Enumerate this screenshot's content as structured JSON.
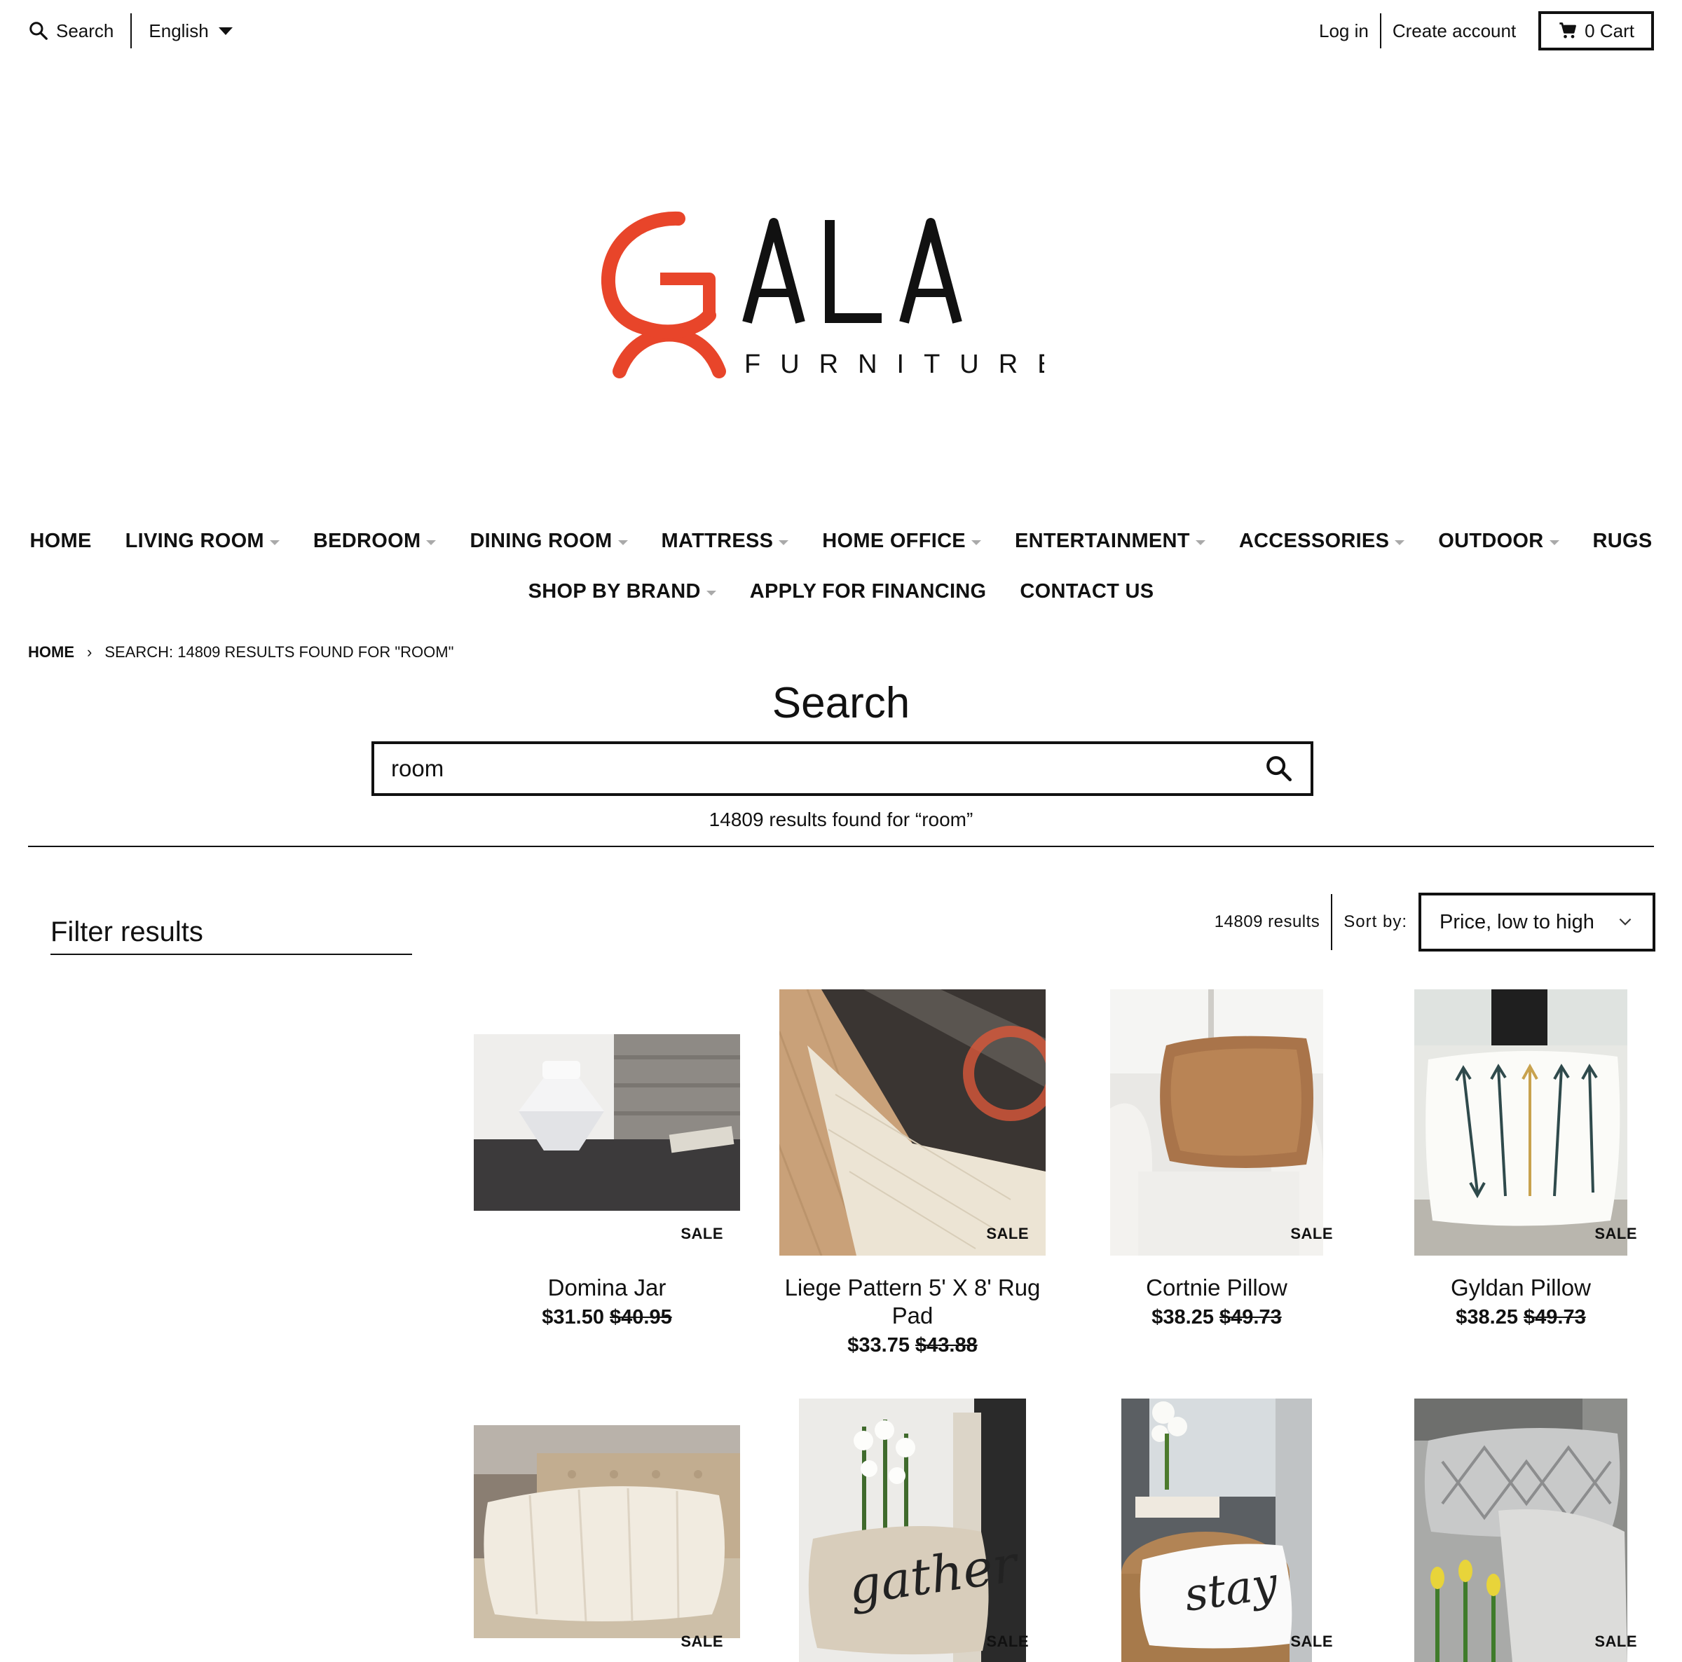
{
  "topbar": {
    "search_label": "Search",
    "language": "English",
    "login": "Log in",
    "create_account": "Create account",
    "cart_count": "0",
    "cart_label": "Cart"
  },
  "logo": {
    "name": "GALA",
    "tagline": "FURNITURE",
    "brand_color": "#e8452a"
  },
  "nav": {
    "row1": [
      "HOME",
      "LIVING ROOM",
      "BEDROOM",
      "DINING ROOM",
      "MATTRESS",
      "HOME OFFICE",
      "ENTERTAINMENT",
      "ACCESSORIES",
      "OUTDOOR",
      "RUGS"
    ],
    "row2": [
      "SHOP BY BRAND",
      "APPLY FOR FINANCING",
      "CONTACT US"
    ]
  },
  "breadcrumb": {
    "home": "HOME",
    "separator": "›",
    "current": "SEARCH: 14809 RESULTS FOUND FOR \"ROOM\""
  },
  "search": {
    "title": "Search",
    "query": "room",
    "results_text": "14809 results found for “room”"
  },
  "filter": {
    "title": "Filter results"
  },
  "sort": {
    "count": "14809 results",
    "label": "Sort by:",
    "selected": "Price, low to high"
  },
  "products": [
    {
      "name": "Domina Jar",
      "price": "$31.50",
      "old_price": "$40.95",
      "badge": "SALE"
    },
    {
      "name": "Liege Pattern 5' X 8' Rug Pad",
      "price": "$33.75",
      "old_price": "$43.88",
      "badge": "SALE"
    },
    {
      "name": "Cortnie Pillow",
      "price": "$38.25",
      "old_price": "$49.73",
      "badge": "SALE"
    },
    {
      "name": "Gyldan Pillow",
      "price": "$38.25",
      "old_price": "$49.73",
      "badge": "SALE"
    },
    {
      "name": "",
      "price": "",
      "old_price": "",
      "badge": "SALE"
    },
    {
      "name": "",
      "price": "",
      "old_price": "",
      "badge": "SALE",
      "image_text": "gather"
    },
    {
      "name": "",
      "price": "",
      "old_price": "",
      "badge": "SALE",
      "image_text": "stay"
    },
    {
      "name": "",
      "price": "",
      "old_price": "",
      "badge": "SALE"
    }
  ]
}
